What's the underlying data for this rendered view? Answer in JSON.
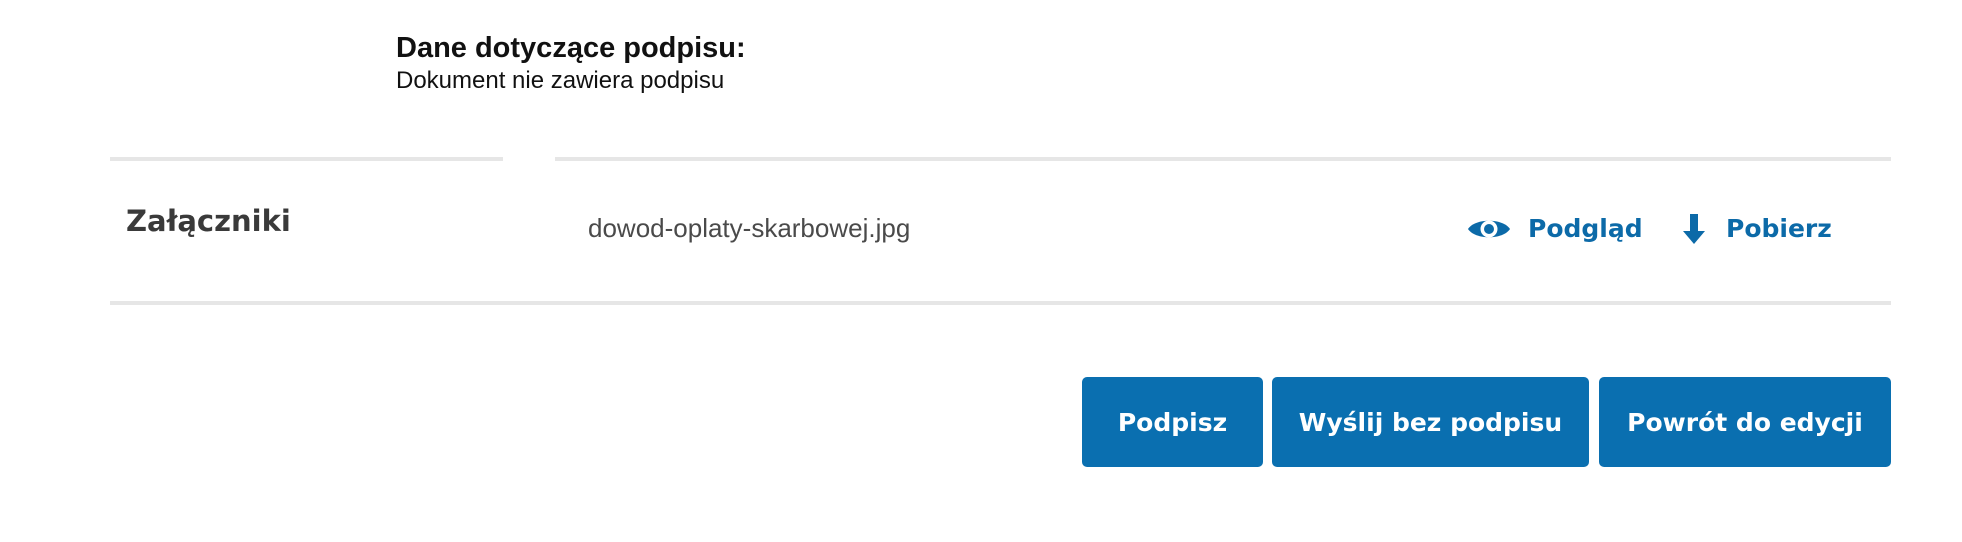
{
  "signature": {
    "heading": "Dane dotyczące podpisu:",
    "status": "Dokument nie zawiera podpisu"
  },
  "attachments": {
    "label": "Załączniki",
    "file_name": "dowod-oplaty-skarbowej.jpg",
    "preview_label": "Podgląd",
    "preview_icon": "eye-icon",
    "download_label": "Pobierz",
    "download_icon": "arrow-down-icon"
  },
  "actions": {
    "sign_label": "Podpisz",
    "send_without_signature_label": "Wyślij bez podpisu",
    "back_to_edit_label": "Powrót do edycji"
  },
  "colors": {
    "accent": "#0a6fb0",
    "link": "#0c6aa8",
    "divider": "#e6e6e6",
    "text": "#111111"
  }
}
